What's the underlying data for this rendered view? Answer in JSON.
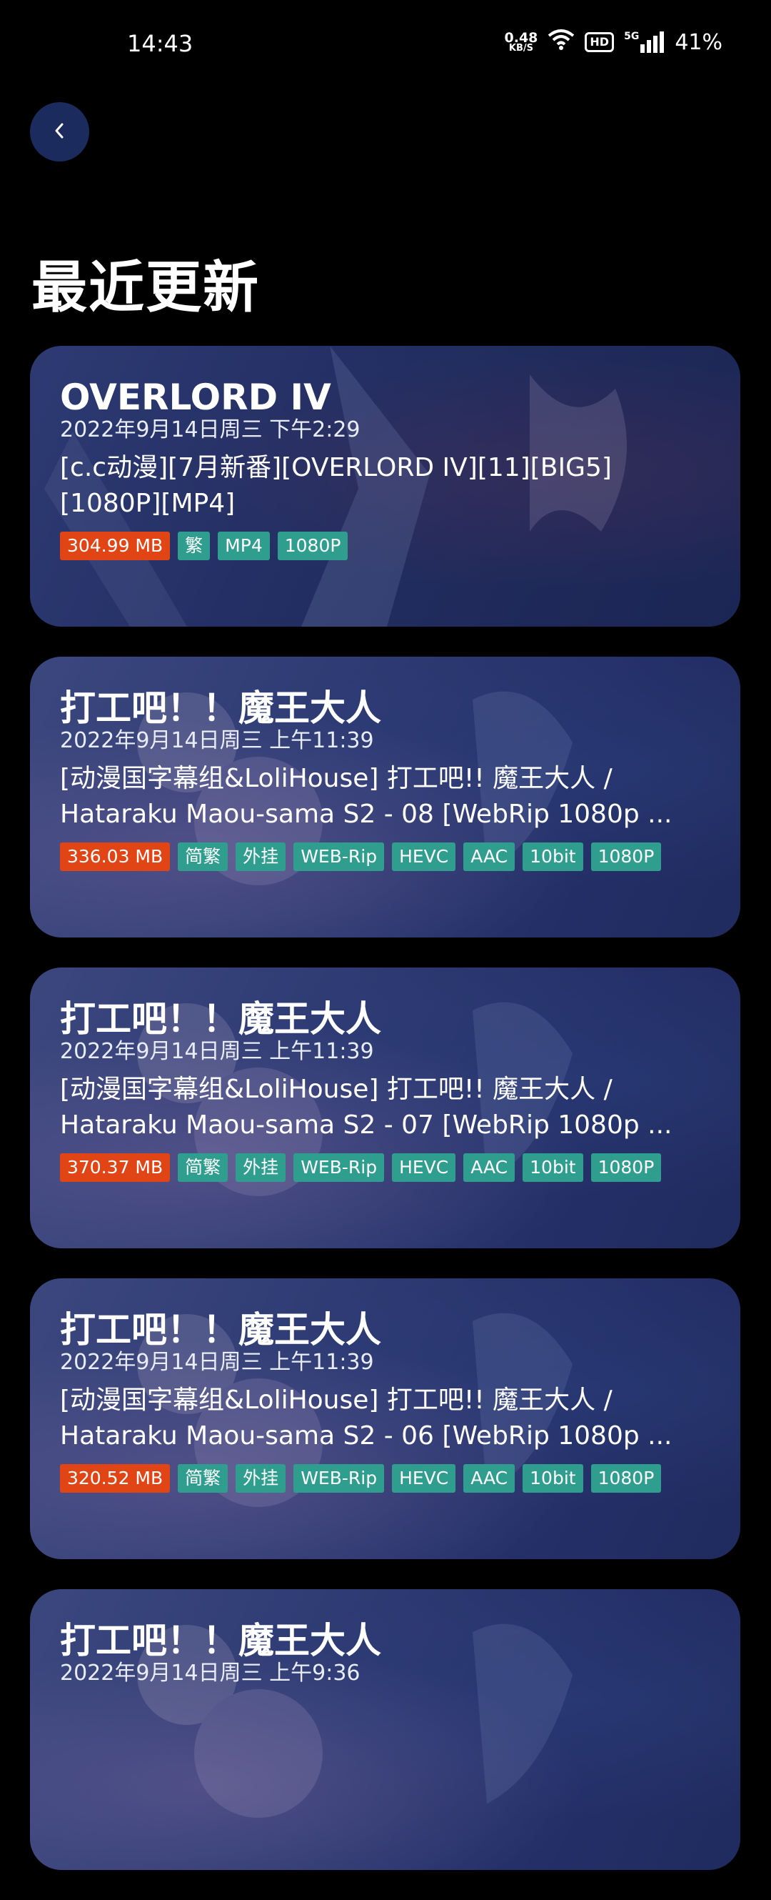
{
  "status_bar": {
    "time": "14:43",
    "net_speed_value": "0.48",
    "net_speed_unit": "KB/S",
    "hd_label": "HD",
    "network_label": "5G",
    "battery": "41%"
  },
  "header": {
    "back_icon": "chevron-left-icon",
    "title": "最近更新"
  },
  "colors": {
    "size_tag": "#e24515",
    "tag": "#2f9e8f",
    "back_button": "#1b2b5e"
  },
  "cards": [
    {
      "title": "OVERLORD IV",
      "date": "2022年9月14日周三 下午2:29",
      "description": "[c.c动漫][7月新番][OVERLORD IV][11][BIG5][1080P][MP4]",
      "size": "304.99 MB",
      "tags": [
        "繁",
        "MP4",
        "1080P"
      ]
    },
    {
      "title": "打工吧！！魔王大人",
      "date": "2022年9月14日周三 上午11:39",
      "description": "[动漫国字幕组&LoliHouse] 打工吧!! 魔王大人 / Hataraku Maou-sama S2 - 08 [WebRip 1080p ...",
      "size": "336.03 MB",
      "tags": [
        "简繁",
        "外挂",
        "WEB-Rip",
        "HEVC",
        "AAC",
        "10bit",
        "1080P"
      ]
    },
    {
      "title": "打工吧！！魔王大人",
      "date": "2022年9月14日周三 上午11:39",
      "description": "[动漫国字幕组&LoliHouse] 打工吧!! 魔王大人 / Hataraku Maou-sama S2 - 07 [WebRip 1080p ...",
      "size": "370.37 MB",
      "tags": [
        "简繁",
        "外挂",
        "WEB-Rip",
        "HEVC",
        "AAC",
        "10bit",
        "1080P"
      ]
    },
    {
      "title": "打工吧！！魔王大人",
      "date": "2022年9月14日周三 上午11:39",
      "description": "[动漫国字幕组&LoliHouse] 打工吧!! 魔王大人 / Hataraku Maou-sama S2 - 06 [WebRip 1080p ...",
      "size": "320.52 MB",
      "tags": [
        "简繁",
        "外挂",
        "WEB-Rip",
        "HEVC",
        "AAC",
        "10bit",
        "1080P"
      ]
    },
    {
      "title": "打工吧！！魔王大人",
      "date": "2022年9月14日周三 上午9:36",
      "description": "",
      "size": "",
      "tags": []
    }
  ]
}
